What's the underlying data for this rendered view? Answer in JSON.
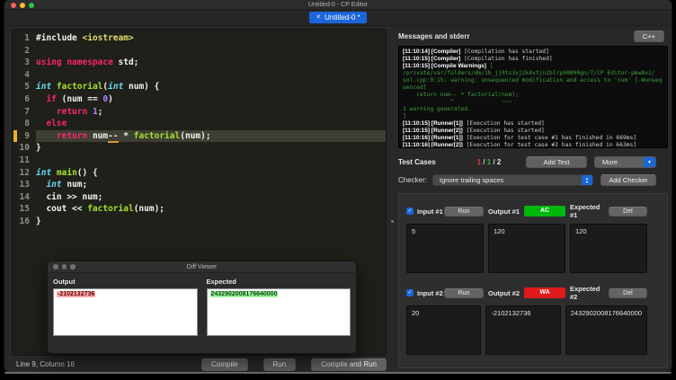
{
  "window": {
    "title": "Untitled-0 - CP Editor"
  },
  "tab": {
    "label": "Untitled-0 *"
  },
  "icons": {
    "tab_close": "✕",
    "checkbox_check": "✓",
    "dropdown_arrow": "▼",
    "stepper_up": "▲",
    "stepper_down": "▼"
  },
  "colors": {
    "accent_blue": "#1b66d9",
    "ac_green": "#00b70c",
    "wa_red": "#e01a1a",
    "warning_green": "#3da03d",
    "active_line_marker": "#e8b01f"
  },
  "editor": {
    "active_line": "9",
    "lines": [
      {
        "n": "1",
        "t": [
          [
            "#include ",
            "w"
          ],
          [
            "<iostream>",
            "y"
          ]
        ]
      },
      {
        "n": "2",
        "t": []
      },
      {
        "n": "3",
        "t": [
          [
            "using namespace",
            "p"
          ],
          [
            " std;",
            "w"
          ]
        ]
      },
      {
        "n": "4",
        "t": []
      },
      {
        "n": "5",
        "t": [
          [
            "int",
            "c"
          ],
          [
            " ",
            "w"
          ],
          [
            "factorial",
            "g"
          ],
          [
            "(",
            "w"
          ],
          [
            "int",
            "c"
          ],
          [
            " num) {",
            "w"
          ]
        ]
      },
      {
        "n": "6",
        "t": [
          [
            "  ",
            "w"
          ],
          [
            "if",
            "p"
          ],
          [
            " (num == ",
            "w"
          ],
          [
            "0",
            "n"
          ],
          [
            ")",
            "w"
          ]
        ]
      },
      {
        "n": "7",
        "t": [
          [
            "    ",
            "w"
          ],
          [
            "return",
            "p"
          ],
          [
            " ",
            "w"
          ],
          [
            "1",
            "n"
          ],
          [
            ";",
            "w"
          ]
        ]
      },
      {
        "n": "8",
        "t": [
          [
            "  ",
            "w"
          ],
          [
            "else",
            "p"
          ]
        ]
      },
      {
        "n": "9",
        "t": [
          [
            "    ",
            "w"
          ],
          [
            "return",
            "p"
          ],
          [
            " num",
            "w"
          ],
          [
            "--",
            "u"
          ],
          [
            " * ",
            "w"
          ],
          [
            "factorial",
            "g"
          ],
          [
            "(num);",
            "w"
          ]
        ]
      },
      {
        "n": "10",
        "t": [
          [
            "}",
            "w"
          ]
        ]
      },
      {
        "n": "11",
        "t": []
      },
      {
        "n": "12",
        "t": [
          [
            "int",
            "c"
          ],
          [
            " ",
            "w"
          ],
          [
            "main",
            "g"
          ],
          [
            "() {",
            "w"
          ]
        ]
      },
      {
        "n": "13",
        "t": [
          [
            "  ",
            "w"
          ],
          [
            "int",
            "c"
          ],
          [
            " num;",
            "w"
          ]
        ]
      },
      {
        "n": "14",
        "t": [
          [
            "  cin >> num;",
            "w"
          ]
        ]
      },
      {
        "n": "15",
        "t": [
          [
            "  cout << ",
            "w"
          ],
          [
            "factorial",
            "g"
          ],
          [
            "(num);",
            "w"
          ]
        ]
      },
      {
        "n": "16",
        "t": [
          [
            "}",
            "w"
          ]
        ]
      }
    ]
  },
  "statusbar": {
    "position": "Line 9, Column 16",
    "compile": "Compile",
    "run": "Run",
    "compile_and_run": "Compile and Run"
  },
  "messages": {
    "title": "Messages and stderr",
    "language_button": "C++",
    "log": [
      {
        "b": "[11:10:14] [Compiler]",
        "t": " [Compilation has started]"
      },
      {
        "b": "[11:10:15] [Compiler]",
        "t": " [Compilation has finished]"
      },
      {
        "b": "[11:10:15] [Compile Warnings]",
        "t": " [",
        "warn": true
      },
      {
        "t": "/private/var/folders/dm/1b_jj0ts3xj2k4xtjn2blrp00000gn/T/CP Editor-pmw8vi/",
        "warn": true
      },
      {
        "t": "sol.cpp:9:15: warning: unsequenced modification and access to 'num' [-Wunsequenced]",
        "warn": true
      },
      {
        "t": "    return num-- * factorial(num);",
        "warn": true
      },
      {
        "t": "              ^              ~~~",
        "warn": true
      },
      {
        "t": "1 warning generated.",
        "warn": true
      },
      {
        "t": "]",
        "warn": true
      },
      {
        "b": "[11:10:15] [Runner[1]]",
        "t": " [Execution has started]"
      },
      {
        "b": "[11:10:15] [Runner[2]]",
        "t": " [Execution has started]"
      },
      {
        "b": "[11:10:16] [Runner[1]]",
        "t": " [Execution for test case #1 has finished in 669ms]"
      },
      {
        "b": "[11:10:16] [Runner[2]]",
        "t": " [Execution for test case #2 has finished in 663ms]"
      }
    ]
  },
  "test_cases": {
    "title": "Test Cases",
    "counts": {
      "red": "1",
      "green": "1",
      "total": "2",
      "sep": " / "
    },
    "add_test": "Add Test",
    "more": "More",
    "checker_label": "Checker:",
    "checker_selected": "Ignore trailing spaces",
    "add_checker": "Add Checker",
    "cases": [
      {
        "input_label": "Input #1",
        "run": "Run",
        "output_label": "Output #1",
        "verdict": "AC",
        "verdict_type": "ac",
        "expected_label": "Expected #1",
        "del": "Del",
        "input": "5",
        "output": "120",
        "expected": "120"
      },
      {
        "input_label": "Input #2",
        "run": "Run",
        "output_label": "Output #2",
        "verdict": "WA",
        "verdict_type": "wa",
        "expected_label": "Expected #2",
        "del": "Del",
        "input": "20",
        "output": "-2102132736",
        "expected": "2432902008176640000"
      }
    ]
  },
  "diff_viewer": {
    "title": "Diff Viewer",
    "output_label": "Output",
    "expected_label": "Expected",
    "output_value": "-2102132736",
    "expected_value": "2432902008176640000"
  }
}
